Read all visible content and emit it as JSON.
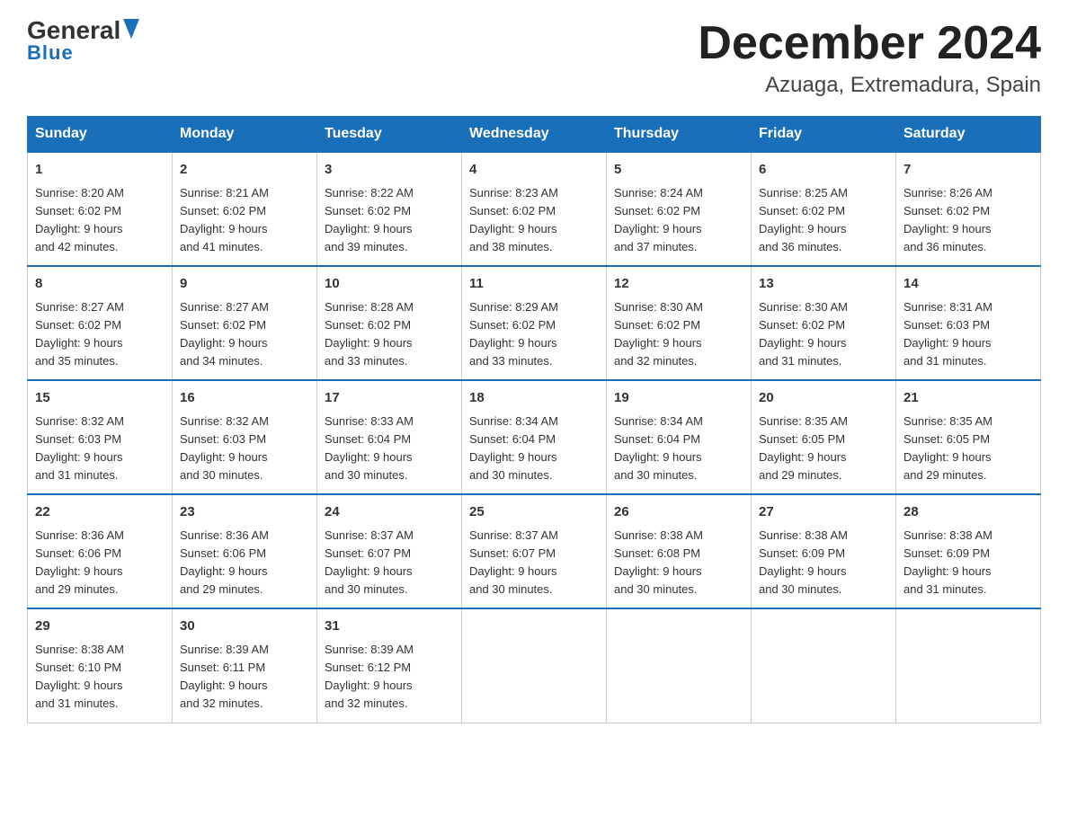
{
  "header": {
    "logo_general": "General",
    "logo_blue": "Blue",
    "month_title": "December 2024",
    "location": "Azuaga, Extremadura, Spain"
  },
  "days_of_week": [
    "Sunday",
    "Monday",
    "Tuesday",
    "Wednesday",
    "Thursday",
    "Friday",
    "Saturday"
  ],
  "weeks": [
    [
      {
        "day": "1",
        "sunrise": "8:20 AM",
        "sunset": "6:02 PM",
        "daylight": "9 hours and 42 minutes."
      },
      {
        "day": "2",
        "sunrise": "8:21 AM",
        "sunset": "6:02 PM",
        "daylight": "9 hours and 41 minutes."
      },
      {
        "day": "3",
        "sunrise": "8:22 AM",
        "sunset": "6:02 PM",
        "daylight": "9 hours and 39 minutes."
      },
      {
        "day": "4",
        "sunrise": "8:23 AM",
        "sunset": "6:02 PM",
        "daylight": "9 hours and 38 minutes."
      },
      {
        "day": "5",
        "sunrise": "8:24 AM",
        "sunset": "6:02 PM",
        "daylight": "9 hours and 37 minutes."
      },
      {
        "day": "6",
        "sunrise": "8:25 AM",
        "sunset": "6:02 PM",
        "daylight": "9 hours and 36 minutes."
      },
      {
        "day": "7",
        "sunrise": "8:26 AM",
        "sunset": "6:02 PM",
        "daylight": "9 hours and 36 minutes."
      }
    ],
    [
      {
        "day": "8",
        "sunrise": "8:27 AM",
        "sunset": "6:02 PM",
        "daylight": "9 hours and 35 minutes."
      },
      {
        "day": "9",
        "sunrise": "8:27 AM",
        "sunset": "6:02 PM",
        "daylight": "9 hours and 34 minutes."
      },
      {
        "day": "10",
        "sunrise": "8:28 AM",
        "sunset": "6:02 PM",
        "daylight": "9 hours and 33 minutes."
      },
      {
        "day": "11",
        "sunrise": "8:29 AM",
        "sunset": "6:02 PM",
        "daylight": "9 hours and 33 minutes."
      },
      {
        "day": "12",
        "sunrise": "8:30 AM",
        "sunset": "6:02 PM",
        "daylight": "9 hours and 32 minutes."
      },
      {
        "day": "13",
        "sunrise": "8:30 AM",
        "sunset": "6:02 PM",
        "daylight": "9 hours and 31 minutes."
      },
      {
        "day": "14",
        "sunrise": "8:31 AM",
        "sunset": "6:03 PM",
        "daylight": "9 hours and 31 minutes."
      }
    ],
    [
      {
        "day": "15",
        "sunrise": "8:32 AM",
        "sunset": "6:03 PM",
        "daylight": "9 hours and 31 minutes."
      },
      {
        "day": "16",
        "sunrise": "8:32 AM",
        "sunset": "6:03 PM",
        "daylight": "9 hours and 30 minutes."
      },
      {
        "day": "17",
        "sunrise": "8:33 AM",
        "sunset": "6:04 PM",
        "daylight": "9 hours and 30 minutes."
      },
      {
        "day": "18",
        "sunrise": "8:34 AM",
        "sunset": "6:04 PM",
        "daylight": "9 hours and 30 minutes."
      },
      {
        "day": "19",
        "sunrise": "8:34 AM",
        "sunset": "6:04 PM",
        "daylight": "9 hours and 30 minutes."
      },
      {
        "day": "20",
        "sunrise": "8:35 AM",
        "sunset": "6:05 PM",
        "daylight": "9 hours and 29 minutes."
      },
      {
        "day": "21",
        "sunrise": "8:35 AM",
        "sunset": "6:05 PM",
        "daylight": "9 hours and 29 minutes."
      }
    ],
    [
      {
        "day": "22",
        "sunrise": "8:36 AM",
        "sunset": "6:06 PM",
        "daylight": "9 hours and 29 minutes."
      },
      {
        "day": "23",
        "sunrise": "8:36 AM",
        "sunset": "6:06 PM",
        "daylight": "9 hours and 29 minutes."
      },
      {
        "day": "24",
        "sunrise": "8:37 AM",
        "sunset": "6:07 PM",
        "daylight": "9 hours and 30 minutes."
      },
      {
        "day": "25",
        "sunrise": "8:37 AM",
        "sunset": "6:07 PM",
        "daylight": "9 hours and 30 minutes."
      },
      {
        "day": "26",
        "sunrise": "8:38 AM",
        "sunset": "6:08 PM",
        "daylight": "9 hours and 30 minutes."
      },
      {
        "day": "27",
        "sunrise": "8:38 AM",
        "sunset": "6:09 PM",
        "daylight": "9 hours and 30 minutes."
      },
      {
        "day": "28",
        "sunrise": "8:38 AM",
        "sunset": "6:09 PM",
        "daylight": "9 hours and 31 minutes."
      }
    ],
    [
      {
        "day": "29",
        "sunrise": "8:38 AM",
        "sunset": "6:10 PM",
        "daylight": "9 hours and 31 minutes."
      },
      {
        "day": "30",
        "sunrise": "8:39 AM",
        "sunset": "6:11 PM",
        "daylight": "9 hours and 32 minutes."
      },
      {
        "day": "31",
        "sunrise": "8:39 AM",
        "sunset": "6:12 PM",
        "daylight": "9 hours and 32 minutes."
      },
      null,
      null,
      null,
      null
    ]
  ],
  "labels": {
    "sunrise": "Sunrise:",
    "sunset": "Sunset:",
    "daylight": "Daylight:"
  }
}
